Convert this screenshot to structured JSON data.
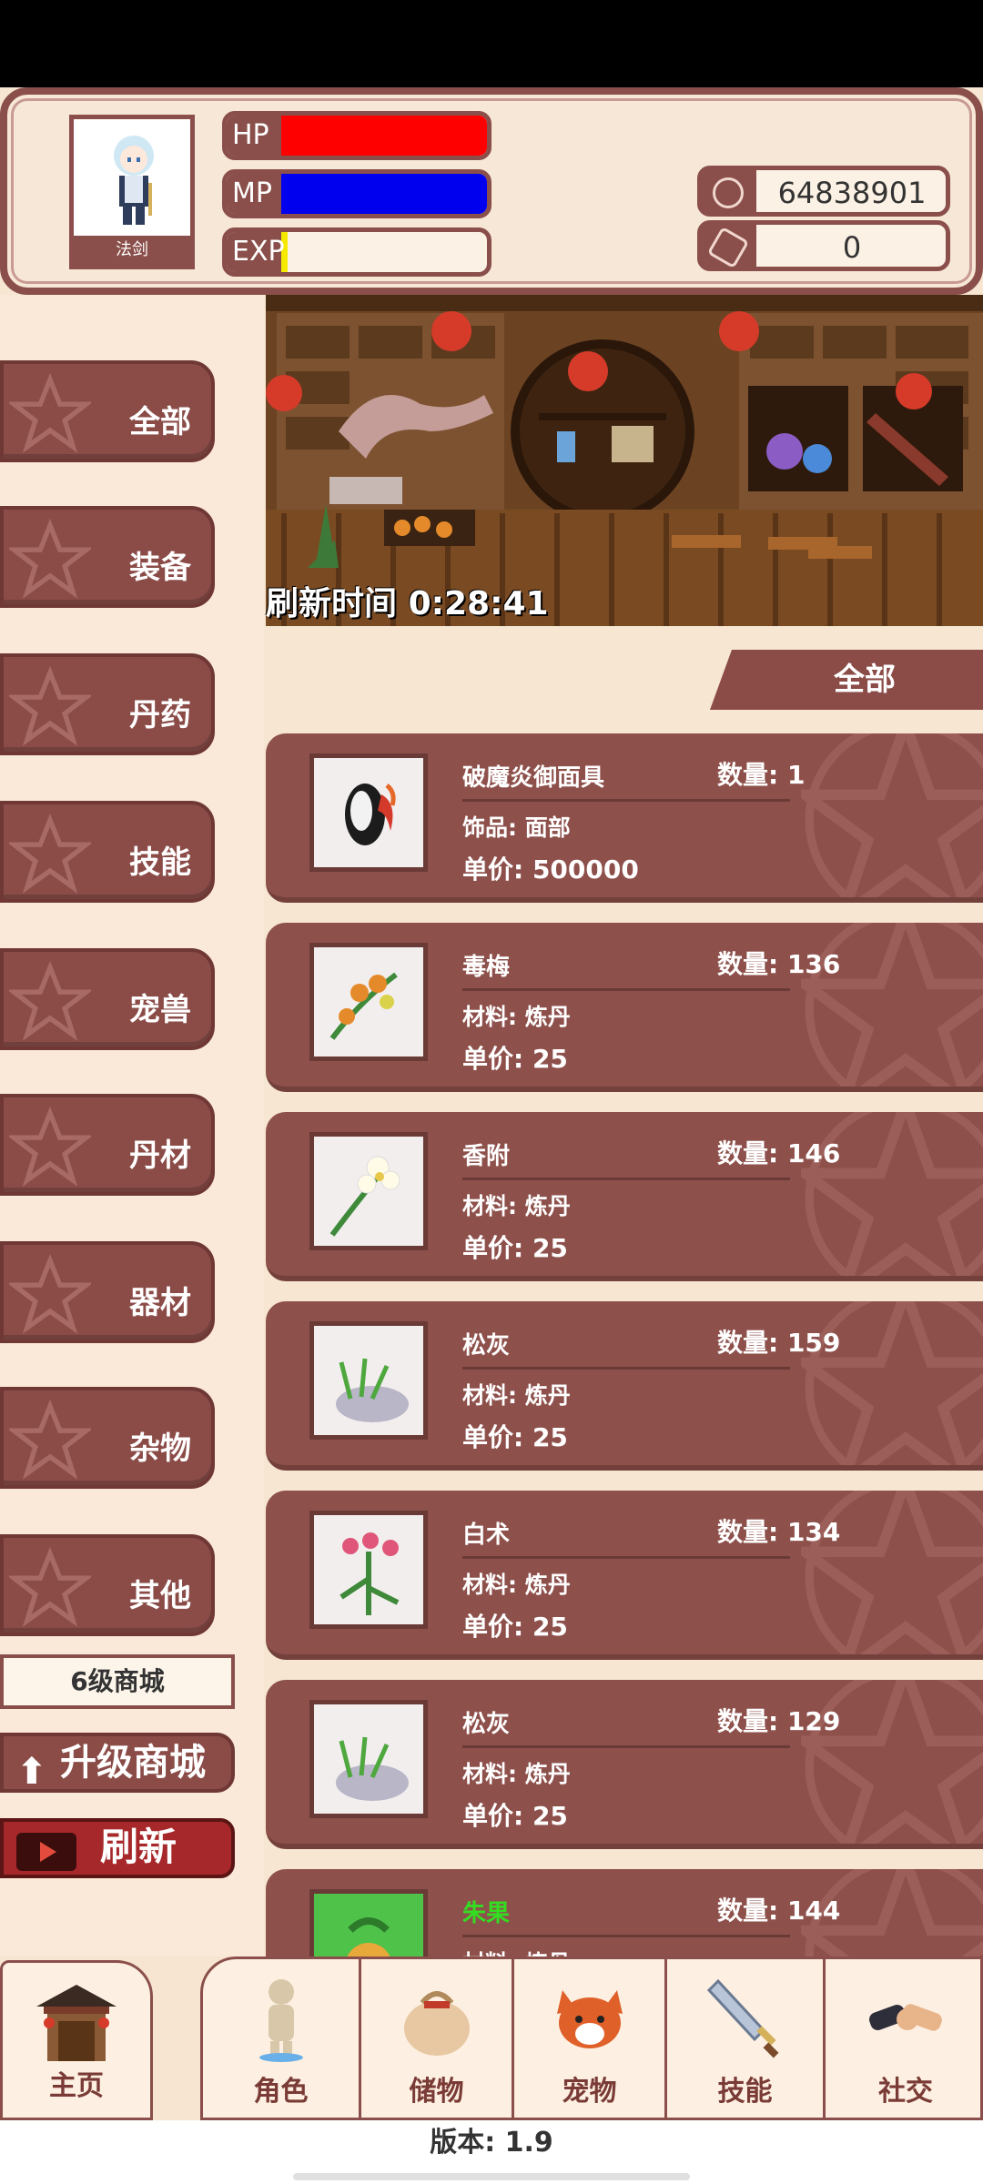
{
  "player": {
    "class_label": "法剑",
    "hp_label": "HP",
    "mp_label": "MP",
    "exp_label": "EXP",
    "hp_fill": 1.0,
    "mp_fill": 1.0,
    "exp_fill": 0.03,
    "gold": "64838901",
    "gems": "0"
  },
  "categories": [
    {
      "label": "全部"
    },
    {
      "label": "装备"
    },
    {
      "label": "丹药"
    },
    {
      "label": "技能"
    },
    {
      "label": "宠兽"
    },
    {
      "label": "丹材"
    },
    {
      "label": "器材"
    },
    {
      "label": "杂物"
    },
    {
      "label": "其他"
    }
  ],
  "shop": {
    "level_label": "6级商城",
    "upgrade_label": "升级商城",
    "refresh_label": "刷新",
    "refresh_time_label": "刷新时间",
    "refresh_time_value": "0:28:41",
    "filter_label": "全部"
  },
  "items": [
    {
      "name": "破魔炎御面具",
      "qty": "数量: 1",
      "category": "饰品: 面部",
      "price": "单价: 500000",
      "name_color": "#ffffff"
    },
    {
      "name": "毒梅",
      "qty": "数量: 136",
      "category": "材料: 炼丹",
      "price": "单价: 25",
      "name_color": "#ffffff"
    },
    {
      "name": "香附",
      "qty": "数量: 146",
      "category": "材料: 炼丹",
      "price": "单价: 25",
      "name_color": "#ffffff"
    },
    {
      "name": "松灰",
      "qty": "数量: 159",
      "category": "材料: 炼丹",
      "price": "单价: 25",
      "name_color": "#ffffff"
    },
    {
      "name": "白术",
      "qty": "数量: 134",
      "category": "材料: 炼丹",
      "price": "单价: 25",
      "name_color": "#ffffff"
    },
    {
      "name": "松灰",
      "qty": "数量: 129",
      "category": "材料: 炼丹",
      "price": "单价: 25",
      "name_color": "#ffffff"
    },
    {
      "name": "朱果",
      "qty": "数量: 144",
      "category": "材料: 炼丹",
      "price": "",
      "name_color": "#33dd22"
    }
  ],
  "nav": {
    "home": "主页",
    "tabs": [
      {
        "label": "角色"
      },
      {
        "label": "储物"
      },
      {
        "label": "宠物"
      },
      {
        "label": "技能"
      },
      {
        "label": "社交"
      }
    ]
  },
  "version": "版本: 1.9"
}
